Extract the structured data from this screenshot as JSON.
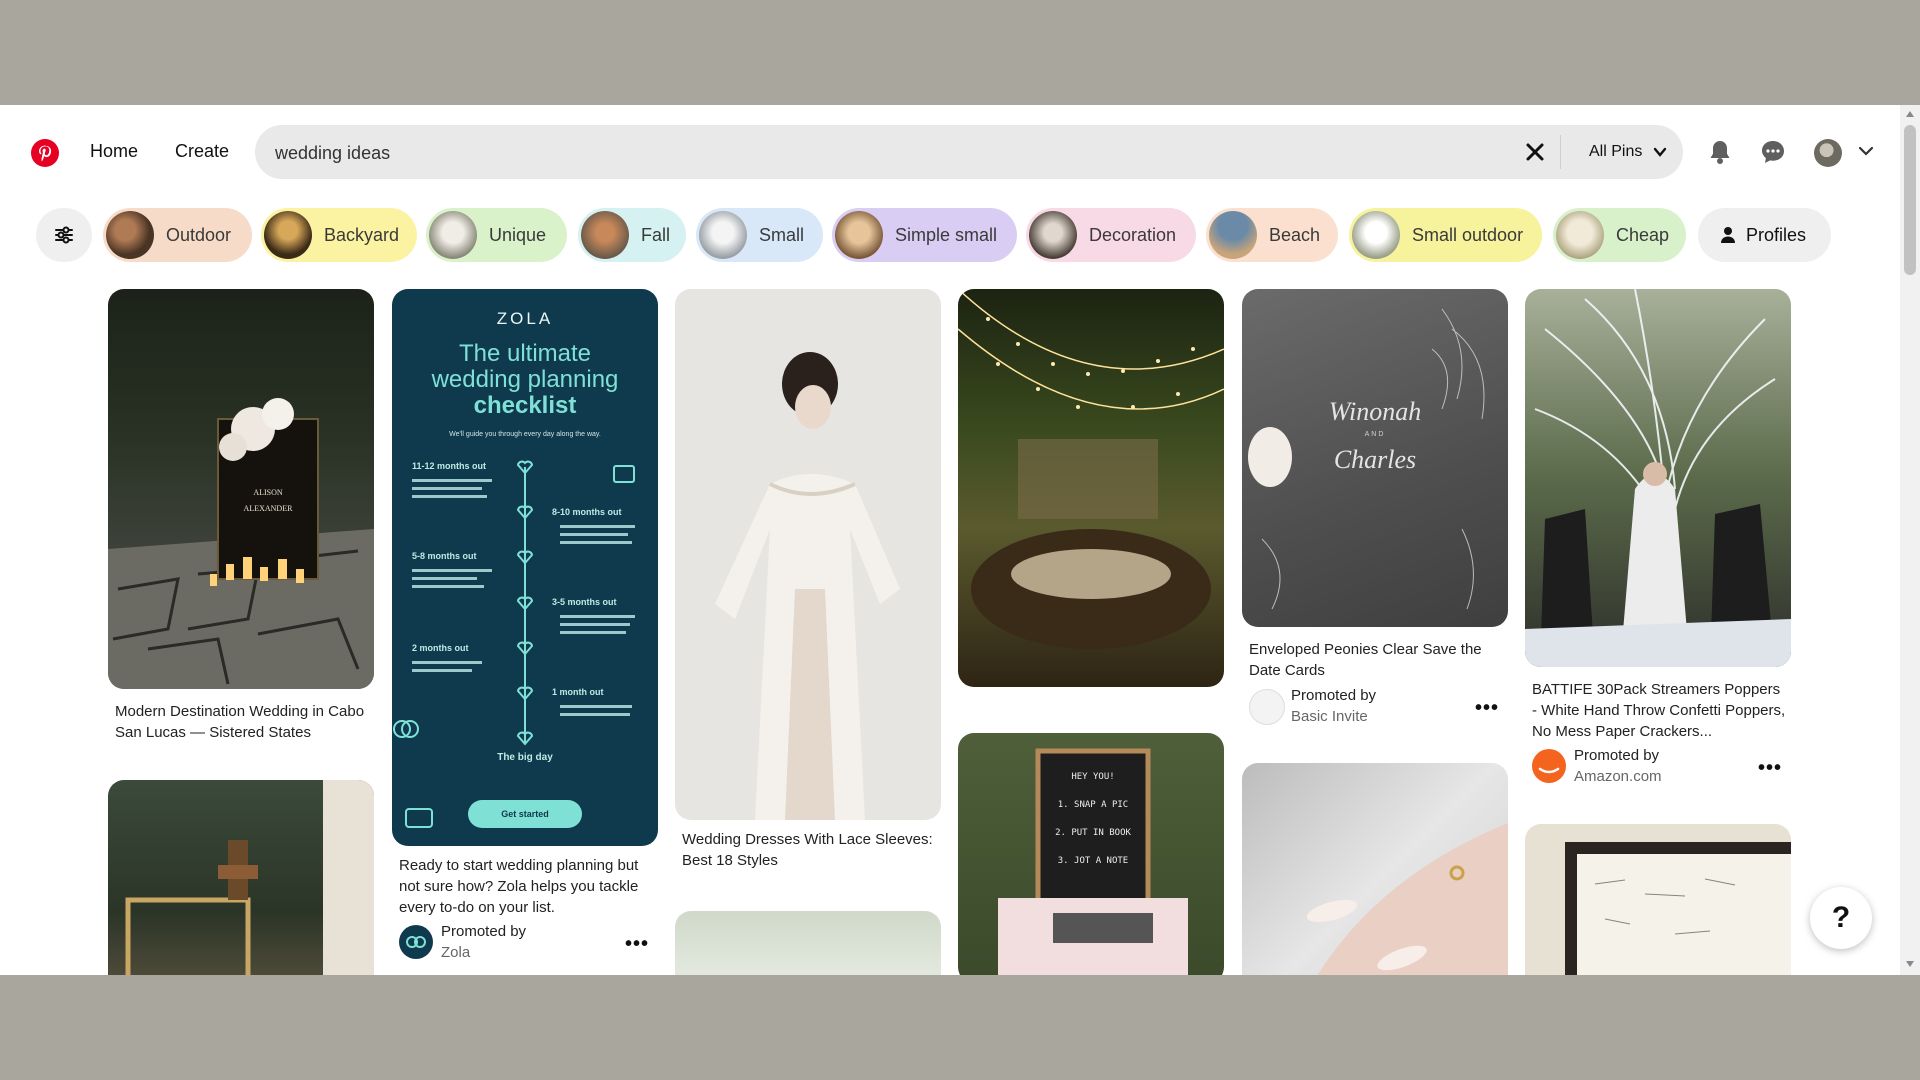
{
  "header": {
    "nav": {
      "home": "Home",
      "create": "Create"
    },
    "search": {
      "value": "wedding ideas",
      "scope": "All Pins"
    },
    "icons": [
      "pinterest-logo",
      "clear-icon",
      "chevron-down-icon",
      "bell-icon",
      "chat-icon",
      "avatar",
      "chevron-down-icon"
    ]
  },
  "chips": [
    {
      "label": "Outdoor",
      "color": "#f6dcc8"
    },
    {
      "label": "Backyard",
      "color": "#fbf2a2"
    },
    {
      "label": "Unique",
      "color": "#d9f2c9"
    },
    {
      "label": "Fall",
      "color": "#d6f1f1"
    },
    {
      "label": "Small",
      "color": "#d8e8f8"
    },
    {
      "label": "Simple small",
      "color": "#d9cdf4"
    },
    {
      "label": "Decoration",
      "color": "#f8d9e6"
    },
    {
      "label": "Beach",
      "color": "#fbe0cf"
    },
    {
      "label": "Small outdoor",
      "color": "#f7f29c"
    },
    {
      "label": "Cheap",
      "color": "#d9f1cb"
    }
  ],
  "profiles_chip": "Profiles",
  "pins": {
    "p1": {
      "title": "Modern Destination Wedding in Cabo San Lucas — Sistered States"
    },
    "p2": {
      "title": "Ready to start wedding planning but not sure how? Zola helps you tackle every to-do on your list.",
      "promoted_by": "Promoted by",
      "brand": "Zola",
      "card": {
        "brand": "ZOLA",
        "headline_1": "The ultimate",
        "headline_2": "wedding planning",
        "headline_3": "checklist",
        "sub": "We'll guide you through every day along the way.",
        "stages": [
          "11-12 months out",
          "8-10 months out",
          "5-8 months out",
          "3-5 months out",
          "2 months out",
          "1 month out"
        ],
        "big_day": "The big day",
        "cta": "Get started"
      }
    },
    "p3": {
      "title": "Wedding Dresses With Lace Sleeves: Best 18 Styles"
    },
    "p5": {
      "title": "Enveloped Peonies Clear Save the Date Cards",
      "promoted_by": "Promoted by",
      "brand": "Basic Invite",
      "card": {
        "name1": "Winonah",
        "and": "AND",
        "name2": "Charles"
      }
    },
    "p6": {
      "title": "BATTIFE 30Pack Streamers Poppers - White Hand Throw Confetti Poppers, No Mess Paper Crackers...",
      "promoted_by": "Promoted by",
      "brand": "Amazon.com"
    },
    "p8": {
      "board_lines": [
        "HEY YOU!",
        "1. SNAP A PIC",
        "2. PUT IN BOOK",
        "3. JOT A NOTE"
      ]
    }
  },
  "more_label": "•••",
  "help": "?"
}
